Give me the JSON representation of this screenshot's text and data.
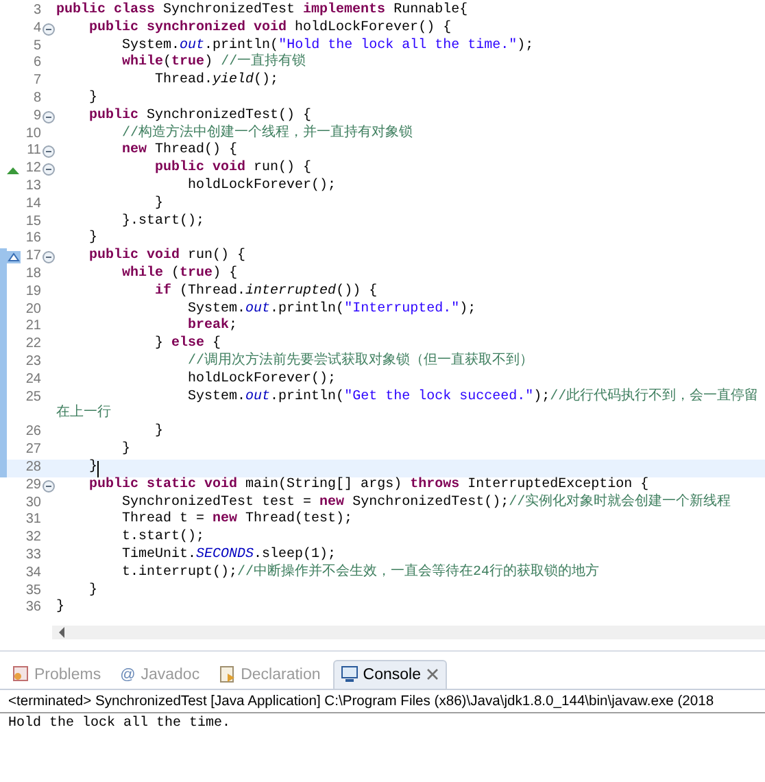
{
  "editor": {
    "lines": [
      {
        "number": "3",
        "fold": false,
        "range": false,
        "current": false,
        "tokens": [
          {
            "kind": "keyword",
            "text": "public class"
          },
          {
            "kind": "plain",
            "text": " SynchronizedTest "
          },
          {
            "kind": "keyword",
            "text": "implements"
          },
          {
            "kind": "plain",
            "text": " Runnable{"
          }
        ]
      },
      {
        "number": "4",
        "fold": true,
        "range": false,
        "current": false,
        "tokens": [
          {
            "kind": "keyword",
            "text": "    public synchronized void"
          },
          {
            "kind": "plain",
            "text": " holdLockForever() {"
          }
        ]
      },
      {
        "number": "5",
        "fold": false,
        "range": false,
        "current": false,
        "tokens": [
          {
            "kind": "plain",
            "text": "        System."
          },
          {
            "kind": "field",
            "text": "out"
          },
          {
            "kind": "plain",
            "text": ".println("
          },
          {
            "kind": "string",
            "text": "\"Hold the lock all the time.\""
          },
          {
            "kind": "plain",
            "text": ");"
          }
        ]
      },
      {
        "number": "6",
        "fold": false,
        "range": false,
        "current": false,
        "tokens": [
          {
            "kind": "keyword",
            "text": "        while"
          },
          {
            "kind": "plain",
            "text": "("
          },
          {
            "kind": "keyword",
            "text": "true"
          },
          {
            "kind": "plain",
            "text": ") "
          },
          {
            "kind": "comment",
            "text": "//一直持有锁"
          }
        ]
      },
      {
        "number": "7",
        "fold": false,
        "range": false,
        "current": false,
        "tokens": [
          {
            "kind": "plain",
            "text": "            Thread."
          },
          {
            "kind": "method",
            "text": "yield"
          },
          {
            "kind": "plain",
            "text": "();"
          }
        ]
      },
      {
        "number": "8",
        "fold": false,
        "range": false,
        "current": false,
        "tokens": [
          {
            "kind": "plain",
            "text": "    }"
          }
        ]
      },
      {
        "number": "9",
        "fold": true,
        "range": false,
        "current": false,
        "tokens": [
          {
            "kind": "keyword",
            "text": "    public"
          },
          {
            "kind": "plain",
            "text": " SynchronizedTest() {"
          }
        ]
      },
      {
        "number": "10",
        "fold": false,
        "range": false,
        "current": false,
        "tokens": [
          {
            "kind": "comment",
            "text": "        //构造方法中创建一个线程，并一直持有对象锁"
          }
        ]
      },
      {
        "number": "11",
        "fold": true,
        "range": false,
        "current": false,
        "tokens": [
          {
            "kind": "keyword",
            "text": "        new"
          },
          {
            "kind": "plain",
            "text": " Thread() {"
          }
        ]
      },
      {
        "number": "12",
        "fold": true,
        "range": false,
        "current": false,
        "kind": "override",
        "tokens": [
          {
            "kind": "keyword",
            "text": "            public void"
          },
          {
            "kind": "plain",
            "text": " run() {"
          }
        ]
      },
      {
        "number": "13",
        "fold": false,
        "range": false,
        "current": false,
        "tokens": [
          {
            "kind": "plain",
            "text": "                holdLockForever();"
          }
        ]
      },
      {
        "number": "14",
        "fold": false,
        "range": false,
        "current": false,
        "tokens": [
          {
            "kind": "plain",
            "text": "            }"
          }
        ]
      },
      {
        "number": "15",
        "fold": false,
        "range": false,
        "current": false,
        "tokens": [
          {
            "kind": "plain",
            "text": "        }.start();"
          }
        ]
      },
      {
        "number": "16",
        "fold": false,
        "range": false,
        "current": false,
        "tokens": [
          {
            "kind": "plain",
            "text": "    }"
          }
        ]
      },
      {
        "number": "17",
        "fold": true,
        "range": true,
        "current": false,
        "kind": "implement",
        "tokens": [
          {
            "kind": "keyword",
            "text": "    public void"
          },
          {
            "kind": "plain",
            "text": " run() {"
          }
        ]
      },
      {
        "number": "18",
        "fold": false,
        "range": true,
        "current": false,
        "tokens": [
          {
            "kind": "keyword",
            "text": "        while"
          },
          {
            "kind": "plain",
            "text": " ("
          },
          {
            "kind": "keyword",
            "text": "true"
          },
          {
            "kind": "plain",
            "text": ") {"
          }
        ]
      },
      {
        "number": "19",
        "fold": false,
        "range": true,
        "current": false,
        "tokens": [
          {
            "kind": "keyword",
            "text": "            if"
          },
          {
            "kind": "plain",
            "text": " (Thread."
          },
          {
            "kind": "method",
            "text": "interrupted"
          },
          {
            "kind": "plain",
            "text": "()) {"
          }
        ]
      },
      {
        "number": "20",
        "fold": false,
        "range": true,
        "current": false,
        "tokens": [
          {
            "kind": "plain",
            "text": "                System."
          },
          {
            "kind": "field",
            "text": "out"
          },
          {
            "kind": "plain",
            "text": ".println("
          },
          {
            "kind": "string",
            "text": "\"Interrupted.\""
          },
          {
            "kind": "plain",
            "text": ");"
          }
        ]
      },
      {
        "number": "21",
        "fold": false,
        "range": true,
        "current": false,
        "tokens": [
          {
            "kind": "keyword",
            "text": "                break"
          },
          {
            "kind": "plain",
            "text": ";"
          }
        ]
      },
      {
        "number": "22",
        "fold": false,
        "range": true,
        "current": false,
        "tokens": [
          {
            "kind": "plain",
            "text": "            } "
          },
          {
            "kind": "keyword",
            "text": "else"
          },
          {
            "kind": "plain",
            "text": " {"
          }
        ]
      },
      {
        "number": "23",
        "fold": false,
        "range": true,
        "current": false,
        "tokens": [
          {
            "kind": "comment",
            "text": "                //调用次方法前先要尝试获取对象锁（但一直获取不到）"
          }
        ]
      },
      {
        "number": "24",
        "fold": false,
        "range": true,
        "current": false,
        "tokens": [
          {
            "kind": "plain",
            "text": "                holdLockForever();"
          }
        ]
      },
      {
        "number": "25",
        "fold": false,
        "range": true,
        "current": false,
        "tokens": [
          {
            "kind": "plain",
            "text": "                System."
          },
          {
            "kind": "field",
            "text": "out"
          },
          {
            "kind": "plain",
            "text": ".println("
          },
          {
            "kind": "string",
            "text": "\"Get the lock succeed.\""
          },
          {
            "kind": "plain",
            "text": ");"
          },
          {
            "kind": "comment",
            "text": "//此行代码执行不到，会一直停留在上一行"
          }
        ]
      },
      {
        "number": "26",
        "fold": false,
        "range": true,
        "current": false,
        "tokens": [
          {
            "kind": "plain",
            "text": "            }"
          }
        ]
      },
      {
        "number": "27",
        "fold": false,
        "range": true,
        "current": false,
        "tokens": [
          {
            "kind": "plain",
            "text": "        }"
          }
        ]
      },
      {
        "number": "28",
        "fold": false,
        "range": true,
        "current": true,
        "tokens": [
          {
            "kind": "plain",
            "text": "    }"
          }
        ]
      },
      {
        "number": "29",
        "fold": true,
        "range": false,
        "current": false,
        "tokens": [
          {
            "kind": "keyword",
            "text": "    public static void"
          },
          {
            "kind": "plain",
            "text": " main(String[] args) "
          },
          {
            "kind": "keyword",
            "text": "throws"
          },
          {
            "kind": "plain",
            "text": " InterruptedException {"
          }
        ]
      },
      {
        "number": "30",
        "fold": false,
        "range": false,
        "current": false,
        "tokens": [
          {
            "kind": "plain",
            "text": "        SynchronizedTest test = "
          },
          {
            "kind": "keyword",
            "text": "new"
          },
          {
            "kind": "plain",
            "text": " SynchronizedTest();"
          },
          {
            "kind": "comment",
            "text": "//实例化对象时就会创建一个新线程"
          }
        ]
      },
      {
        "number": "31",
        "fold": false,
        "range": false,
        "current": false,
        "tokens": [
          {
            "kind": "plain",
            "text": "        Thread t = "
          },
          {
            "kind": "keyword",
            "text": "new"
          },
          {
            "kind": "plain",
            "text": " Thread(test);"
          }
        ]
      },
      {
        "number": "32",
        "fold": false,
        "range": false,
        "current": false,
        "tokens": [
          {
            "kind": "plain",
            "text": "        t.start();"
          }
        ]
      },
      {
        "number": "33",
        "fold": false,
        "range": false,
        "current": false,
        "tokens": [
          {
            "kind": "plain",
            "text": "        TimeUnit."
          },
          {
            "kind": "field",
            "text": "SECONDS"
          },
          {
            "kind": "plain",
            "text": ".sleep(1);"
          }
        ]
      },
      {
        "number": "34",
        "fold": false,
        "range": false,
        "current": false,
        "tokens": [
          {
            "kind": "plain",
            "text": "        t.interrupt();"
          },
          {
            "kind": "comment",
            "text": "//中断操作并不会生效，一直会等待在24行的获取锁的地方"
          }
        ]
      },
      {
        "number": "35",
        "fold": false,
        "range": false,
        "current": false,
        "tokens": [
          {
            "kind": "plain",
            "text": "    }"
          }
        ]
      },
      {
        "number": "36",
        "fold": false,
        "range": false,
        "current": false,
        "tokens": [
          {
            "kind": "plain",
            "text": "}"
          }
        ]
      }
    ]
  },
  "console": {
    "tabs": [
      {
        "label": "Problems",
        "kind": "problems",
        "selected": false,
        "closable": false
      },
      {
        "label": "Javadoc",
        "kind": "glyph",
        "glyph": "@",
        "selected": false,
        "closable": false
      },
      {
        "label": "Declaration",
        "kind": "declaration",
        "selected": false,
        "closable": false
      },
      {
        "label": "Console",
        "kind": "console",
        "selected": true,
        "closable": true
      }
    ],
    "header": "<terminated> SynchronizedTest [Java Application] C:\\Program Files (x86)\\Java\\jdk1.8.0_144\\bin\\javaw.exe (2018",
    "output": "Hold the lock all the time."
  }
}
